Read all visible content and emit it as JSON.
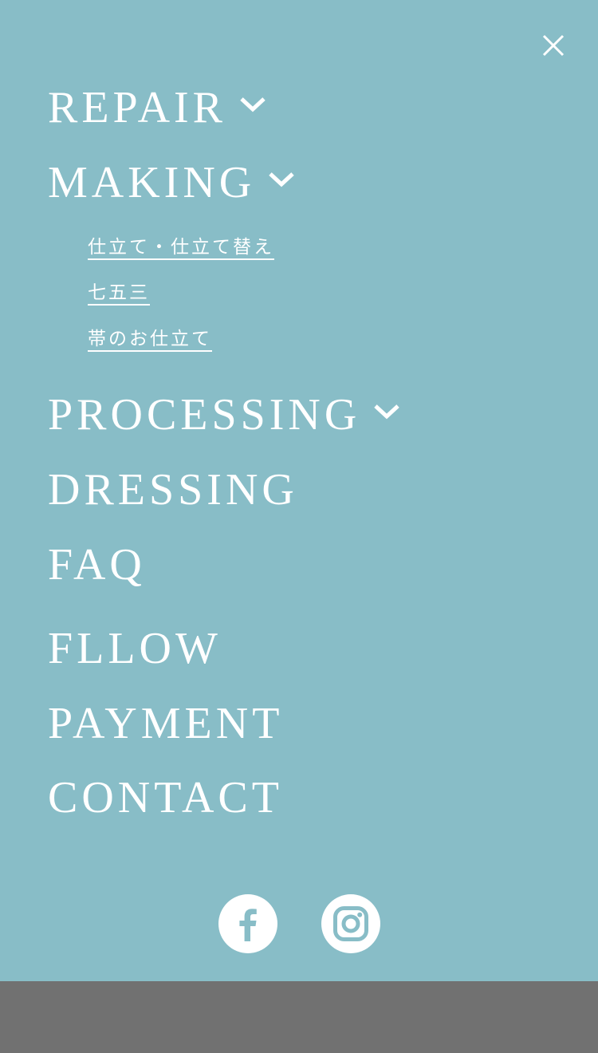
{
  "menu": {
    "close_label": "close",
    "items": [
      {
        "label": "REPAIR",
        "has_submenu": true,
        "expanded": false
      },
      {
        "label": "MAKING",
        "has_submenu": true,
        "expanded": true,
        "submenu": [
          "仕立て・仕立て替え",
          "七五三",
          "帯のお仕立て"
        ]
      },
      {
        "label": "PROCESSING",
        "has_submenu": true,
        "expanded": false
      },
      {
        "label": "DRESSING",
        "has_submenu": false
      },
      {
        "label": "FAQ",
        "has_submenu": false
      },
      {
        "label": "FLLOW",
        "has_submenu": false
      },
      {
        "label": "PAYMENT",
        "has_submenu": false
      },
      {
        "label": "CONTACT",
        "has_submenu": false
      }
    ]
  },
  "social": {
    "icons": [
      "facebook-icon",
      "instagram-icon"
    ]
  },
  "colors": {
    "panel_background": "#88bdc7",
    "page_background": "#717171",
    "text": "#ffffff"
  }
}
